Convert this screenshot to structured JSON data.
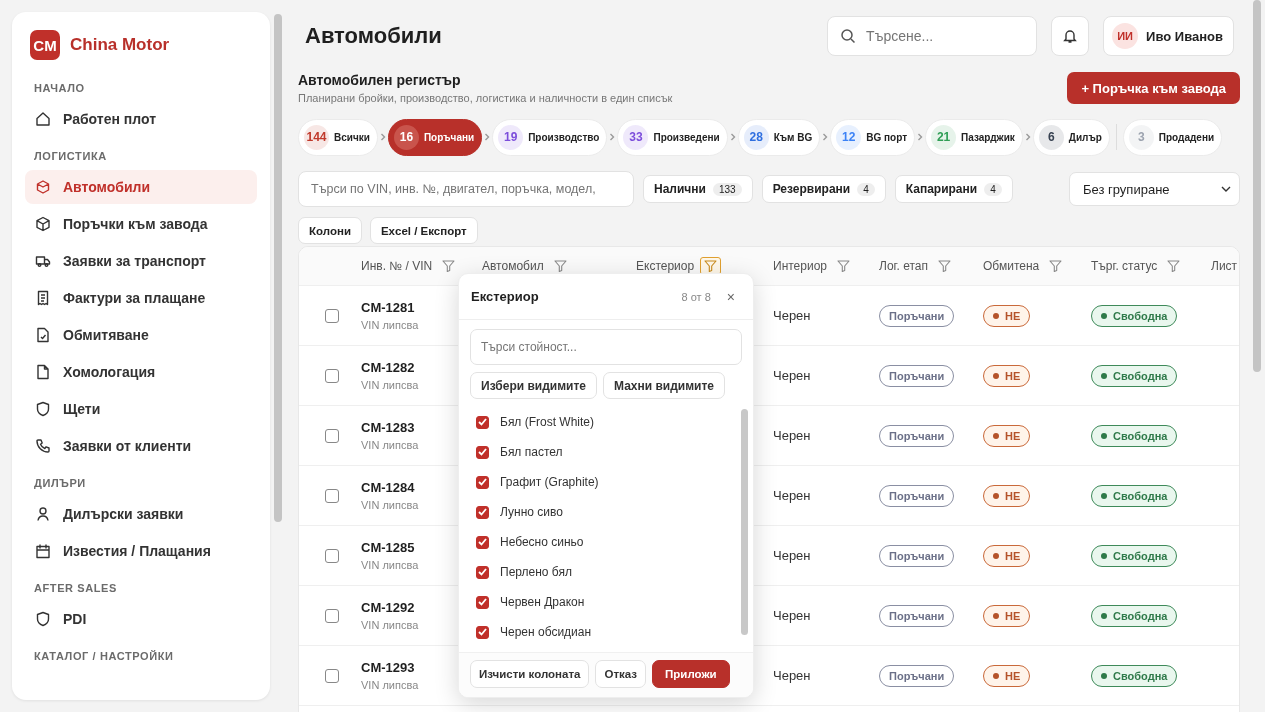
{
  "sidebar": {
    "logo": {
      "mark": "CM",
      "name": "China Motor"
    },
    "sections": [
      {
        "title": "НАЧАЛО",
        "items": [
          {
            "label": "Работен плот",
            "selected": false
          }
        ]
      },
      {
        "title": "ЛОГИСТИКА",
        "items": [
          {
            "label": "Автомобили",
            "selected": true
          },
          {
            "label": "Поръчки към завода",
            "selected": false
          },
          {
            "label": "Заявки за транспорт",
            "selected": false
          },
          {
            "label": "Фактури за плащане",
            "selected": false
          },
          {
            "label": "Обмитяване",
            "selected": false
          },
          {
            "label": "Хомологация",
            "selected": false
          },
          {
            "label": "Щети",
            "selected": false
          },
          {
            "label": "Заявки от клиенти",
            "selected": false
          }
        ]
      },
      {
        "title": "ДИЛЪРИ",
        "items": [
          {
            "label": "Дилърски заявки",
            "selected": false
          },
          {
            "label": "Известия / Плащания",
            "selected": false
          }
        ]
      },
      {
        "title": "AFTER SALES",
        "items": [
          {
            "label": "PDI",
            "selected": false
          }
        ]
      },
      {
        "title": "КАТАЛОГ / НАСТРОЙКИ"
      }
    ]
  },
  "header": {
    "title": "Автомобили",
    "search": {
      "placeholder": "Търсене..."
    },
    "user": {
      "initials": "ИИ",
      "name": "Иво Иванов"
    }
  },
  "register": {
    "title": "Автомобилен регистър",
    "subtitle": "Планирани бройки, производство, логистика и наличности в един списък",
    "primary_button": "+ Поръчка към завода"
  },
  "stage_groups": [
    {
      "items": [
        {
          "count": "144",
          "label": "Всички",
          "color": "#c0392b",
          "selected": false
        },
        {
          "count": "16",
          "label": "Поръчани",
          "color": "#c9544c",
          "selected": true
        },
        {
          "count": "19",
          "label": "Производство",
          "color": "#7c4ddb",
          "selected": false
        },
        {
          "count": "33",
          "label": "Произведени",
          "color": "#7c4ddb",
          "selected": false
        },
        {
          "count": "28",
          "label": "Към BG",
          "color": "#2f6fe0",
          "selected": false
        },
        {
          "count": "12",
          "label": "BG порт",
          "color": "#3b82f6",
          "selected": false
        },
        {
          "count": "21",
          "label": "Пазарджик",
          "color": "#2f9e55",
          "selected": false
        },
        {
          "count": "6",
          "label": "Дилър",
          "color": "#374151",
          "selected": false
        }
      ]
    },
    {
      "items": [
        {
          "count": "3",
          "label": "Продадени",
          "color": "#9ca3af",
          "selected": false
        }
      ]
    }
  ],
  "filters": {
    "search": {
      "placeholder": "Търси по VIN, инв. №, двигател, поръчка, модел,"
    },
    "chips": [
      {
        "label": "Налични",
        "count": "133"
      },
      {
        "label": "Резервирани",
        "count": "4"
      },
      {
        "label": "Капарирани",
        "count": "4"
      }
    ],
    "grouping": "Без групиране"
  },
  "toolbar": [
    "Колони",
    "Excel / Експорт"
  ],
  "table": {
    "columns": [
      {
        "label": "Инв. № / VIN",
        "kind": "filter",
        "filter_open": false
      },
      {
        "label": "Автомобил",
        "kind": "filter",
        "filter_open": false
      },
      {
        "label": "Екстериор",
        "kind": "filter",
        "filter_open": true
      },
      {
        "label": "Интериор",
        "kind": "filter",
        "filter_open": false
      },
      {
        "label": "Лог. етап",
        "kind": "filter",
        "filter_open": false
      },
      {
        "label": "Обмитена",
        "kind": "filter",
        "filter_open": false
      },
      {
        "label": "Търг. статус",
        "kind": "filter",
        "filter_open": false
      },
      {
        "label": "Лист",
        "kind": "plain"
      }
    ],
    "rows": [
      {
        "checked": false,
        "id": "CM-1281",
        "vin": "VIN липсва",
        "interior": "Черен",
        "stage": "Поръчани",
        "cleared": "НЕ",
        "trade_status": "Свободна"
      },
      {
        "checked": false,
        "id": "CM-1282",
        "vin": "VIN липсва",
        "interior": "Черен",
        "stage": "Поръчани",
        "cleared": "НЕ",
        "trade_status": "Свободна"
      },
      {
        "checked": false,
        "id": "CM-1283",
        "vin": "VIN липсва",
        "interior": "Черен",
        "stage": "Поръчани",
        "cleared": "НЕ",
        "trade_status": "Свободна"
      },
      {
        "checked": false,
        "id": "CM-1284",
        "vin": "VIN липсва",
        "interior": "Черен",
        "stage": "Поръчани",
        "cleared": "НЕ",
        "trade_status": "Свободна"
      },
      {
        "checked": false,
        "id": "CM-1285",
        "vin": "VIN липсва",
        "interior": "Черен",
        "stage": "Поръчани",
        "cleared": "НЕ",
        "trade_status": "Свободна"
      },
      {
        "checked": false,
        "id": "CM-1292",
        "vin": "VIN липсва",
        "interior": "Черен",
        "stage": "Поръчани",
        "cleared": "НЕ",
        "trade_status": "Свободна"
      },
      {
        "checked": false,
        "id": "CM-1293",
        "vin": "VIN липсва",
        "interior": "Черен",
        "stage": "Поръчани",
        "cleared": "НЕ",
        "trade_status": "Свободна"
      }
    ]
  },
  "filter_popup": {
    "title": "Екстериор",
    "count": "8 от 8",
    "close": "×",
    "search": {
      "placeholder": "Търси стойност..."
    },
    "actions": [
      "Избери видимите",
      "Махни видимите"
    ],
    "options": [
      {
        "label": "Бял (Frost White)",
        "checked": true
      },
      {
        "label": "Бял пастел",
        "checked": true
      },
      {
        "label": "Графит (Graphite)",
        "checked": true
      },
      {
        "label": "Лунно сиво",
        "checked": true
      },
      {
        "label": "Небесно синьо",
        "checked": true
      },
      {
        "label": "Перлено бял",
        "checked": true
      },
      {
        "label": "Червен Дракон",
        "checked": true
      },
      {
        "label": "Черен обсидиан",
        "checked": true
      }
    ],
    "footer": [
      {
        "label": "Изчисти колоната",
        "kind": "secondary"
      },
      {
        "label": "Отказ",
        "kind": "secondary"
      },
      {
        "label": "Приложи",
        "kind": "primary"
      }
    ]
  }
}
